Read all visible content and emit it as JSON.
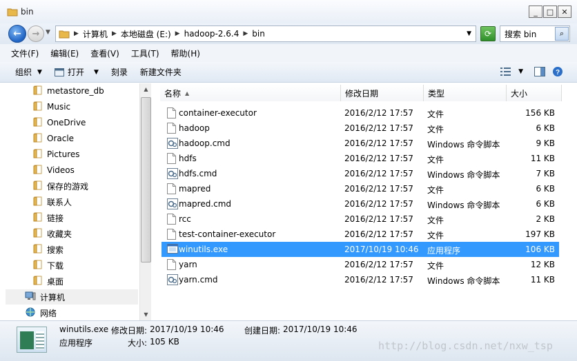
{
  "window": {
    "title": "bin"
  },
  "nav": {
    "breadcrumbs": [
      "计算机",
      "本地磁盘 (E:)",
      "hadoop-2.6.4",
      "bin"
    ],
    "search_placeholder": "搜索 bin"
  },
  "menu": [
    "文件(F)",
    "编辑(E)",
    "查看(V)",
    "工具(T)",
    "帮助(H)"
  ],
  "commands": {
    "organize": "组织",
    "open": "打开",
    "burn": "刻录",
    "new_folder": "新建文件夹"
  },
  "sidebar": {
    "items": [
      {
        "label": "metastore_db",
        "icon": "folder"
      },
      {
        "label": "Music",
        "icon": "folder"
      },
      {
        "label": "OneDrive",
        "icon": "folder"
      },
      {
        "label": "Oracle",
        "icon": "folder"
      },
      {
        "label": "Pictures",
        "icon": "folder"
      },
      {
        "label": "Videos",
        "icon": "folder"
      },
      {
        "label": "保存的游戏",
        "icon": "folder"
      },
      {
        "label": "联系人",
        "icon": "folder"
      },
      {
        "label": "链接",
        "icon": "folder"
      },
      {
        "label": "收藏夹",
        "icon": "folder"
      },
      {
        "label": "搜索",
        "icon": "folder"
      },
      {
        "label": "下载",
        "icon": "folder"
      },
      {
        "label": "桌面",
        "icon": "folder"
      },
      {
        "label": "计算机",
        "icon": "computer"
      },
      {
        "label": "网络",
        "icon": "network"
      }
    ]
  },
  "columns": {
    "name": "名称",
    "modified": "修改日期",
    "type": "类型",
    "size": "大小"
  },
  "files": [
    {
      "name": "container-executor",
      "modified": "2016/2/12 17:57",
      "type": "文件",
      "size": "156 KB",
      "icon": "file"
    },
    {
      "name": "hadoop",
      "modified": "2016/2/12 17:57",
      "type": "文件",
      "size": "6 KB",
      "icon": "file"
    },
    {
      "name": "hadoop.cmd",
      "modified": "2016/2/12 17:57",
      "type": "Windows 命令脚本",
      "size": "9 KB",
      "icon": "cmd"
    },
    {
      "name": "hdfs",
      "modified": "2016/2/12 17:57",
      "type": "文件",
      "size": "11 KB",
      "icon": "file"
    },
    {
      "name": "hdfs.cmd",
      "modified": "2016/2/12 17:57",
      "type": "Windows 命令脚本",
      "size": "7 KB",
      "icon": "cmd"
    },
    {
      "name": "mapred",
      "modified": "2016/2/12 17:57",
      "type": "文件",
      "size": "6 KB",
      "icon": "file"
    },
    {
      "name": "mapred.cmd",
      "modified": "2016/2/12 17:57",
      "type": "Windows 命令脚本",
      "size": "6 KB",
      "icon": "cmd"
    },
    {
      "name": "rcc",
      "modified": "2016/2/12 17:57",
      "type": "文件",
      "size": "2 KB",
      "icon": "file"
    },
    {
      "name": "test-container-executor",
      "modified": "2016/2/12 17:57",
      "type": "文件",
      "size": "197 KB",
      "icon": "file"
    },
    {
      "name": "winutils.exe",
      "modified": "2017/10/19 10:46",
      "type": "应用程序",
      "size": "106 KB",
      "icon": "exe",
      "selected": true
    },
    {
      "name": "yarn",
      "modified": "2016/2/12 17:57",
      "type": "文件",
      "size": "12 KB",
      "icon": "file"
    },
    {
      "name": "yarn.cmd",
      "modified": "2016/2/12 17:57",
      "type": "Windows 命令脚本",
      "size": "11 KB",
      "icon": "cmd"
    }
  ],
  "details": {
    "name": "winutils.exe",
    "modified_label": "修改日期:",
    "modified": "2017/10/19 10:46",
    "created_label": "创建日期:",
    "created": "2017/10/19 10:46",
    "type": "应用程序",
    "size_label": "大小:",
    "size": "105 KB"
  },
  "watermark": "http://blog.csdn.net/nxw_tsp",
  "colors": {
    "selection": "#3399ff",
    "folder": "#e8b84a"
  }
}
